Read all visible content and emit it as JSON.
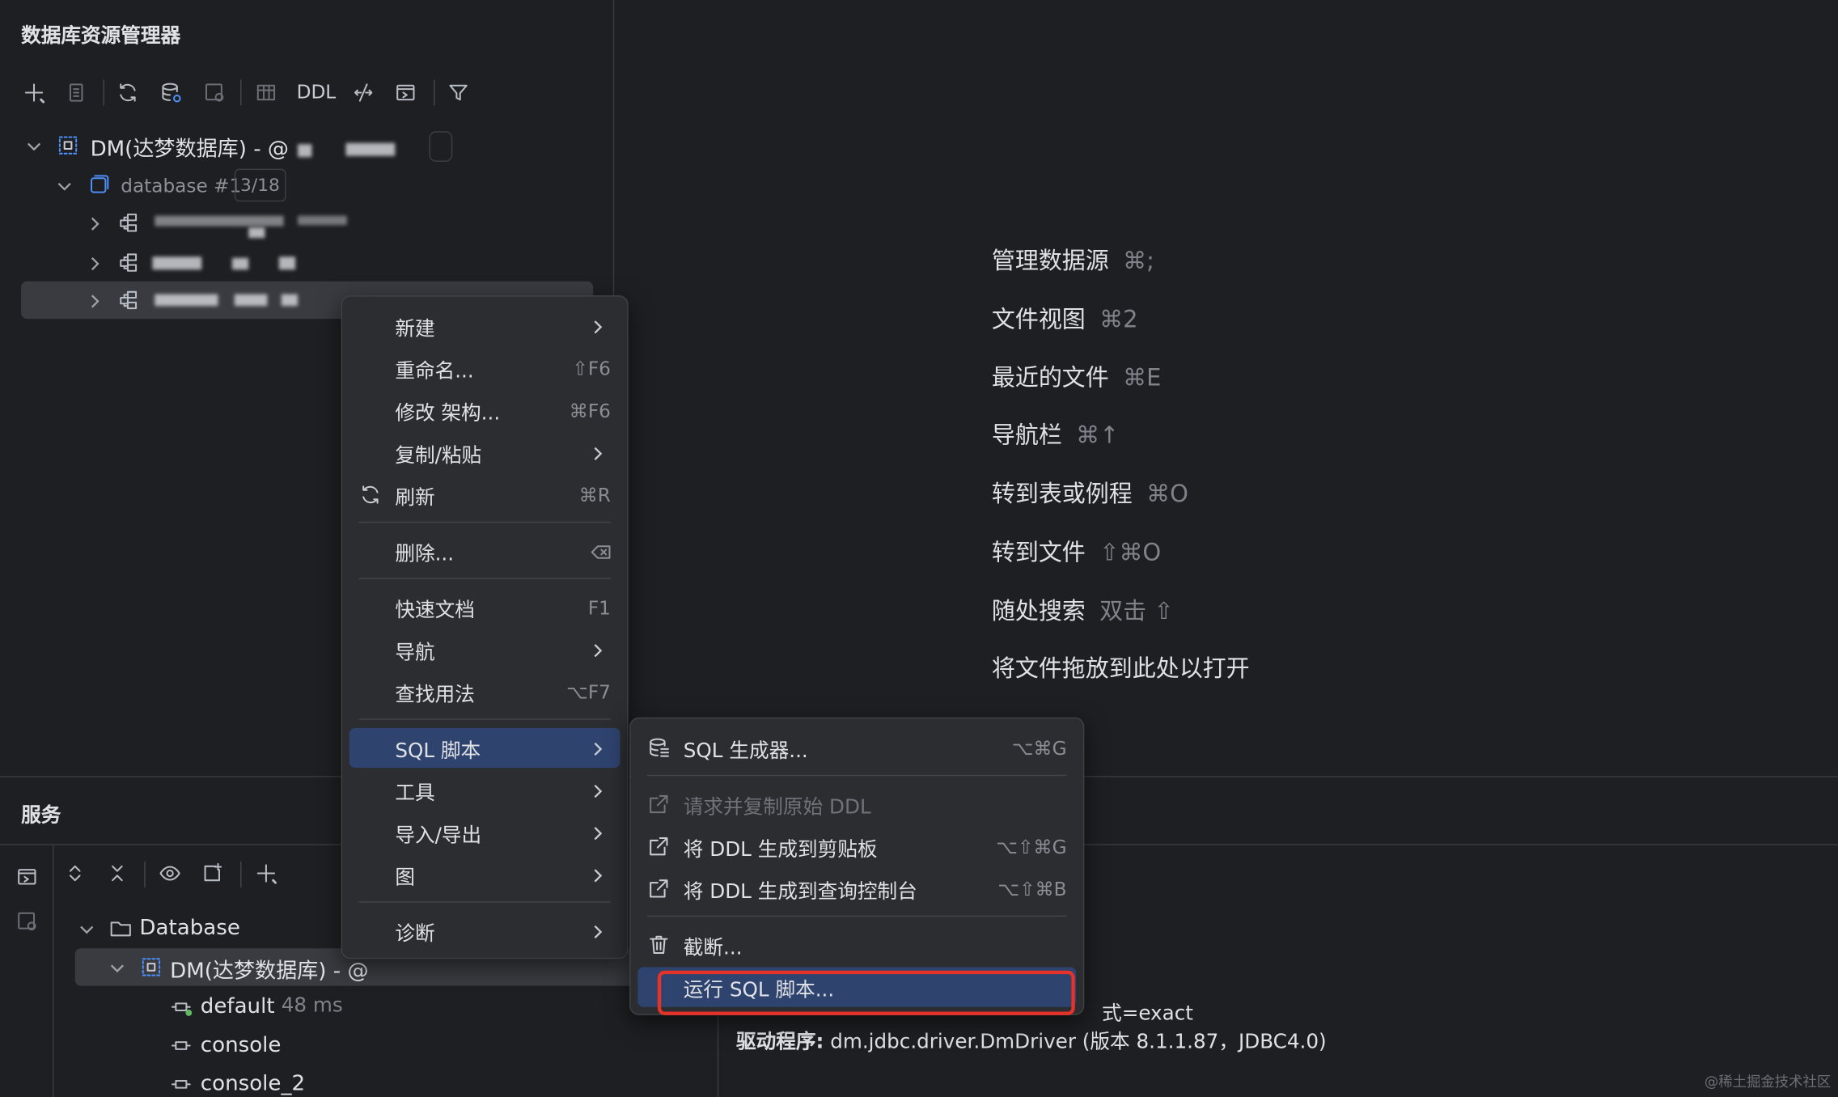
{
  "explorer": {
    "title": "数据库资源管理器",
    "toolbar_ddl": "DDL",
    "root_label": "DM(达梦数据库) - @",
    "database_label": "database #1",
    "database_badge": "3/18"
  },
  "empty_hints": [
    {
      "label": "管理数据源",
      "key": "⌘;"
    },
    {
      "label": "文件视图",
      "key": "⌘2"
    },
    {
      "label": "最近的文件",
      "key": "⌘E"
    },
    {
      "label": "导航栏",
      "key": "⌘↑"
    },
    {
      "label": "转到表或例程",
      "key": "⌘O"
    },
    {
      "label": "转到文件",
      "key": "⇧⌘O"
    },
    {
      "label": "随处搜索",
      "key": "双击 ⇧"
    },
    {
      "label": "将文件拖放到此处以打开",
      "key": ""
    }
  ],
  "services": {
    "title": "服务",
    "tree": {
      "database": "Database",
      "dm": "DM(达梦数据库) - @",
      "default": "default",
      "default_time": "48 ms",
      "console": "console",
      "console2": "console_2"
    },
    "output_line1": "式=exact",
    "output_line2_prefix": "驱动程序:",
    "output_line2_rest": " dm.jdbc.driver.DmDriver (版本 8.1.1.87，JDBC4.0)"
  },
  "context_menu": {
    "items": [
      {
        "label": "新建",
        "shortcut": ""
      },
      {
        "label": "重命名...",
        "shortcut": "⇧F6"
      },
      {
        "label": "修改 架构...",
        "shortcut": "⌘F6"
      },
      {
        "label": "复制/粘贴",
        "shortcut": ""
      },
      {
        "label": "刷新",
        "shortcut": "⌘R"
      },
      {
        "label": "删除...",
        "shortcut": ""
      },
      {
        "label": "快速文档",
        "shortcut": "F1"
      },
      {
        "label": "导航",
        "shortcut": ""
      },
      {
        "label": "查找用法",
        "shortcut": "⌥F7"
      },
      {
        "label": "SQL 脚本",
        "shortcut": ""
      },
      {
        "label": "工具",
        "shortcut": ""
      },
      {
        "label": "导入/导出",
        "shortcut": ""
      },
      {
        "label": "图",
        "shortcut": ""
      },
      {
        "label": "诊断",
        "shortcut": ""
      }
    ]
  },
  "submenu": {
    "items": [
      {
        "label": "SQL 生成器...",
        "shortcut": "⌥⌘G"
      },
      {
        "label": "请求并复制原始 DDL",
        "shortcut": ""
      },
      {
        "label": "将 DDL 生成到剪贴板",
        "shortcut": "⌥⇧⌘G"
      },
      {
        "label": "将 DDL 生成到查询控制台",
        "shortcut": "⌥⇧⌘B"
      },
      {
        "label": "截断...",
        "shortcut": ""
      },
      {
        "label": "运行 SQL 脚本...",
        "shortcut": ""
      }
    ]
  },
  "watermark": "@稀土掘金技术社区",
  "colors": {
    "background": "#1e1f22",
    "menu_bg": "#2b2d30",
    "selection": "#2e436e",
    "tree_selection": "#393b40",
    "highlight_border": "#e5332a",
    "text": "#dfe1e5",
    "muted": "#7f828a"
  }
}
